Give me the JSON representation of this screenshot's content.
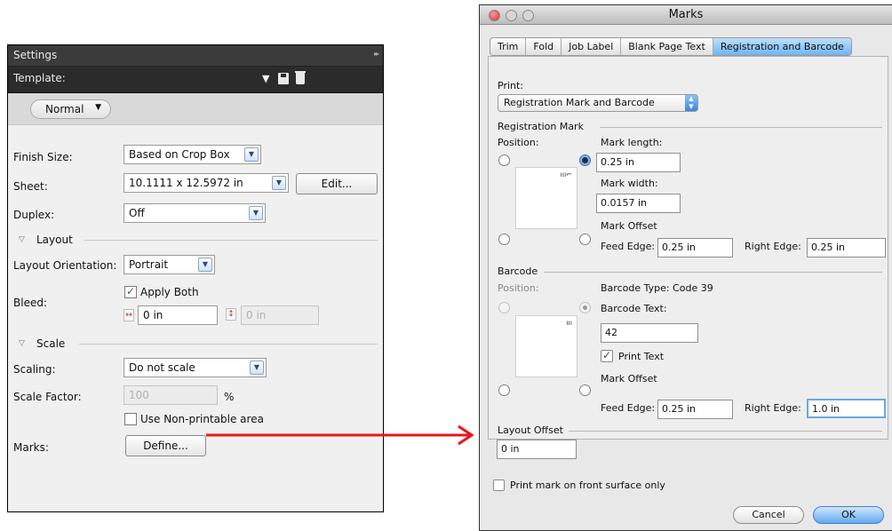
{
  "settings": {
    "title": "Settings",
    "template_label": "Template:",
    "mode_value": "Normal",
    "finish_size": {
      "label": "Finish Size:",
      "value": "Based on Crop Box"
    },
    "sheet": {
      "label": "Sheet:",
      "value": "10.1111 x 12.5972 in",
      "edit_button": "Edit..."
    },
    "duplex": {
      "label": "Duplex:",
      "value": "Off"
    },
    "layout_section": "Layout",
    "layout_orientation": {
      "label": "Layout Orientation:",
      "value": "Portrait"
    },
    "bleed": {
      "label": "Bleed:",
      "apply_both": "Apply Both",
      "apply_both_checked": true,
      "horizontal": "0 in",
      "vertical": "0 in"
    },
    "scale_section": "Scale",
    "scaling": {
      "label": "Scaling:",
      "value": "Do not scale"
    },
    "scale_factor": {
      "label": "Scale Factor:",
      "value": "100",
      "unit": "%"
    },
    "non_printable": {
      "label": "Use Non-printable area",
      "checked": false
    },
    "marks": {
      "label": "Marks:",
      "define_button": "Define..."
    }
  },
  "marks_dialog": {
    "title": "Marks",
    "tabs": [
      "Trim",
      "Fold",
      "Job Label",
      "Blank Page Text",
      "Registration and Barcode"
    ],
    "active_tab": "Registration and Barcode",
    "print_label": "Print:",
    "print_value": "Registration Mark and Barcode",
    "registration": {
      "section": "Registration Mark",
      "position_label": "Position:",
      "mark_length_label": "Mark length:",
      "mark_length": "0.25 in",
      "mark_width_label": "Mark width:",
      "mark_width": "0.0157 in",
      "mark_offset_label": "Mark Offset",
      "feed_edge_label": "Feed Edge:",
      "feed_edge": "0.25 in",
      "right_edge_label": "Right Edge:",
      "right_edge": "0.25 in"
    },
    "barcode": {
      "section": "Barcode",
      "position_label": "Position:",
      "type_label": "Barcode Type: Code 39",
      "text_label": "Barcode Text:",
      "text_value": "42",
      "print_text_label": "Print Text",
      "print_text_checked": true,
      "mark_offset_label": "Mark Offset",
      "feed_edge_label": "Feed Edge:",
      "feed_edge": "0.25 in",
      "right_edge_label": "Right Edge:",
      "right_edge": "1.0 in"
    },
    "layout_offset_label": "Layout Offset",
    "layout_offset": "0 in",
    "front_surface_label": "Print mark on front surface only",
    "front_surface_checked": false,
    "cancel_button": "Cancel",
    "ok_button": "OK"
  },
  "colors": {
    "annotation_red": "#e8161b",
    "active_tab": "#6fb4f2",
    "panel_dark": "#3b3b3b"
  },
  "icons": [
    "save-icon",
    "trash-icon",
    "chevron-down-icon",
    "horizontal-bleed-icon",
    "vertical-bleed-icon",
    "checkmark-icon"
  ]
}
